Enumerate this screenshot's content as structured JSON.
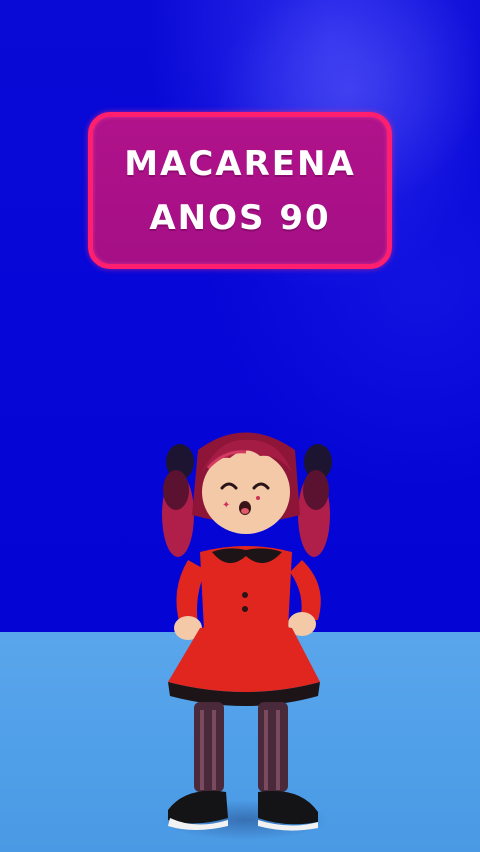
{
  "title_card": {
    "line1": "MACARENA",
    "line2": "ANOS 90"
  },
  "scene": {
    "wall_color": "#0606d8",
    "floor_color": "#4e9ee8",
    "card_fill": "#a50f86",
    "card_border": "#ff1f6e"
  },
  "avatar": {
    "name": "dancing-avatar",
    "dress_color": "#e0261e",
    "hair_color": "#b01e4a"
  }
}
